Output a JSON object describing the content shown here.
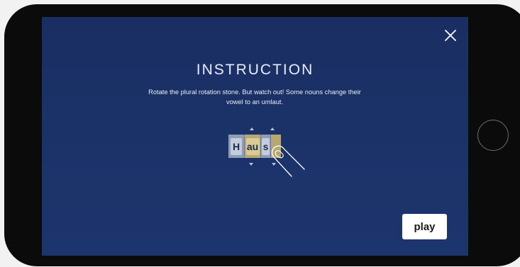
{
  "instruction": {
    "title": "INSTRUCTION",
    "description": "Rotate the plural rotation stone. But watch out! Some nouns change their vowel to an umlaut."
  },
  "stone": {
    "tiles": [
      "H",
      "au",
      "s",
      ""
    ]
  },
  "buttons": {
    "play_label": "play"
  },
  "colors": {
    "screen_background": "#1b3369",
    "stone_blue": "#c3cddd",
    "stone_gold": "#d8cb93",
    "text": "#e7ecf7"
  },
  "icons": {
    "close": "close-icon",
    "hand": "hand-pointer-icon",
    "arrows": "triangle-arrow-icon"
  }
}
